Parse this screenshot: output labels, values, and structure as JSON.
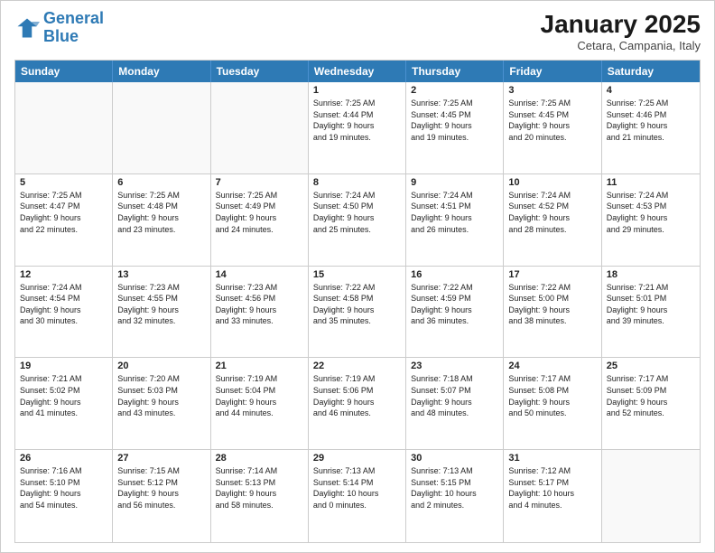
{
  "header": {
    "logo_line1": "General",
    "logo_line2": "Blue",
    "month_title": "January 2025",
    "subtitle": "Cetara, Campania, Italy"
  },
  "days_of_week": [
    "Sunday",
    "Monday",
    "Tuesday",
    "Wednesday",
    "Thursday",
    "Friday",
    "Saturday"
  ],
  "weeks": [
    [
      {
        "day": "",
        "empty": true,
        "lines": []
      },
      {
        "day": "",
        "empty": true,
        "lines": []
      },
      {
        "day": "",
        "empty": true,
        "lines": []
      },
      {
        "day": "1",
        "empty": false,
        "lines": [
          "Sunrise: 7:25 AM",
          "Sunset: 4:44 PM",
          "Daylight: 9 hours",
          "and 19 minutes."
        ]
      },
      {
        "day": "2",
        "empty": false,
        "lines": [
          "Sunrise: 7:25 AM",
          "Sunset: 4:45 PM",
          "Daylight: 9 hours",
          "and 19 minutes."
        ]
      },
      {
        "day": "3",
        "empty": false,
        "lines": [
          "Sunrise: 7:25 AM",
          "Sunset: 4:45 PM",
          "Daylight: 9 hours",
          "and 20 minutes."
        ]
      },
      {
        "day": "4",
        "empty": false,
        "lines": [
          "Sunrise: 7:25 AM",
          "Sunset: 4:46 PM",
          "Daylight: 9 hours",
          "and 21 minutes."
        ]
      }
    ],
    [
      {
        "day": "5",
        "empty": false,
        "lines": [
          "Sunrise: 7:25 AM",
          "Sunset: 4:47 PM",
          "Daylight: 9 hours",
          "and 22 minutes."
        ]
      },
      {
        "day": "6",
        "empty": false,
        "lines": [
          "Sunrise: 7:25 AM",
          "Sunset: 4:48 PM",
          "Daylight: 9 hours",
          "and 23 minutes."
        ]
      },
      {
        "day": "7",
        "empty": false,
        "lines": [
          "Sunrise: 7:25 AM",
          "Sunset: 4:49 PM",
          "Daylight: 9 hours",
          "and 24 minutes."
        ]
      },
      {
        "day": "8",
        "empty": false,
        "lines": [
          "Sunrise: 7:24 AM",
          "Sunset: 4:50 PM",
          "Daylight: 9 hours",
          "and 25 minutes."
        ]
      },
      {
        "day": "9",
        "empty": false,
        "lines": [
          "Sunrise: 7:24 AM",
          "Sunset: 4:51 PM",
          "Daylight: 9 hours",
          "and 26 minutes."
        ]
      },
      {
        "day": "10",
        "empty": false,
        "lines": [
          "Sunrise: 7:24 AM",
          "Sunset: 4:52 PM",
          "Daylight: 9 hours",
          "and 28 minutes."
        ]
      },
      {
        "day": "11",
        "empty": false,
        "lines": [
          "Sunrise: 7:24 AM",
          "Sunset: 4:53 PM",
          "Daylight: 9 hours",
          "and 29 minutes."
        ]
      }
    ],
    [
      {
        "day": "12",
        "empty": false,
        "lines": [
          "Sunrise: 7:24 AM",
          "Sunset: 4:54 PM",
          "Daylight: 9 hours",
          "and 30 minutes."
        ]
      },
      {
        "day": "13",
        "empty": false,
        "lines": [
          "Sunrise: 7:23 AM",
          "Sunset: 4:55 PM",
          "Daylight: 9 hours",
          "and 32 minutes."
        ]
      },
      {
        "day": "14",
        "empty": false,
        "lines": [
          "Sunrise: 7:23 AM",
          "Sunset: 4:56 PM",
          "Daylight: 9 hours",
          "and 33 minutes."
        ]
      },
      {
        "day": "15",
        "empty": false,
        "lines": [
          "Sunrise: 7:22 AM",
          "Sunset: 4:58 PM",
          "Daylight: 9 hours",
          "and 35 minutes."
        ]
      },
      {
        "day": "16",
        "empty": false,
        "lines": [
          "Sunrise: 7:22 AM",
          "Sunset: 4:59 PM",
          "Daylight: 9 hours",
          "and 36 minutes."
        ]
      },
      {
        "day": "17",
        "empty": false,
        "lines": [
          "Sunrise: 7:22 AM",
          "Sunset: 5:00 PM",
          "Daylight: 9 hours",
          "and 38 minutes."
        ]
      },
      {
        "day": "18",
        "empty": false,
        "lines": [
          "Sunrise: 7:21 AM",
          "Sunset: 5:01 PM",
          "Daylight: 9 hours",
          "and 39 minutes."
        ]
      }
    ],
    [
      {
        "day": "19",
        "empty": false,
        "lines": [
          "Sunrise: 7:21 AM",
          "Sunset: 5:02 PM",
          "Daylight: 9 hours",
          "and 41 minutes."
        ]
      },
      {
        "day": "20",
        "empty": false,
        "lines": [
          "Sunrise: 7:20 AM",
          "Sunset: 5:03 PM",
          "Daylight: 9 hours",
          "and 43 minutes."
        ]
      },
      {
        "day": "21",
        "empty": false,
        "lines": [
          "Sunrise: 7:19 AM",
          "Sunset: 5:04 PM",
          "Daylight: 9 hours",
          "and 44 minutes."
        ]
      },
      {
        "day": "22",
        "empty": false,
        "lines": [
          "Sunrise: 7:19 AM",
          "Sunset: 5:06 PM",
          "Daylight: 9 hours",
          "and 46 minutes."
        ]
      },
      {
        "day": "23",
        "empty": false,
        "lines": [
          "Sunrise: 7:18 AM",
          "Sunset: 5:07 PM",
          "Daylight: 9 hours",
          "and 48 minutes."
        ]
      },
      {
        "day": "24",
        "empty": false,
        "lines": [
          "Sunrise: 7:17 AM",
          "Sunset: 5:08 PM",
          "Daylight: 9 hours",
          "and 50 minutes."
        ]
      },
      {
        "day": "25",
        "empty": false,
        "lines": [
          "Sunrise: 7:17 AM",
          "Sunset: 5:09 PM",
          "Daylight: 9 hours",
          "and 52 minutes."
        ]
      }
    ],
    [
      {
        "day": "26",
        "empty": false,
        "lines": [
          "Sunrise: 7:16 AM",
          "Sunset: 5:10 PM",
          "Daylight: 9 hours",
          "and 54 minutes."
        ]
      },
      {
        "day": "27",
        "empty": false,
        "lines": [
          "Sunrise: 7:15 AM",
          "Sunset: 5:12 PM",
          "Daylight: 9 hours",
          "and 56 minutes."
        ]
      },
      {
        "day": "28",
        "empty": false,
        "lines": [
          "Sunrise: 7:14 AM",
          "Sunset: 5:13 PM",
          "Daylight: 9 hours",
          "and 58 minutes."
        ]
      },
      {
        "day": "29",
        "empty": false,
        "lines": [
          "Sunrise: 7:13 AM",
          "Sunset: 5:14 PM",
          "Daylight: 10 hours",
          "and 0 minutes."
        ]
      },
      {
        "day": "30",
        "empty": false,
        "lines": [
          "Sunrise: 7:13 AM",
          "Sunset: 5:15 PM",
          "Daylight: 10 hours",
          "and 2 minutes."
        ]
      },
      {
        "day": "31",
        "empty": false,
        "lines": [
          "Sunrise: 7:12 AM",
          "Sunset: 5:17 PM",
          "Daylight: 10 hours",
          "and 4 minutes."
        ]
      },
      {
        "day": "",
        "empty": true,
        "lines": []
      }
    ]
  ]
}
